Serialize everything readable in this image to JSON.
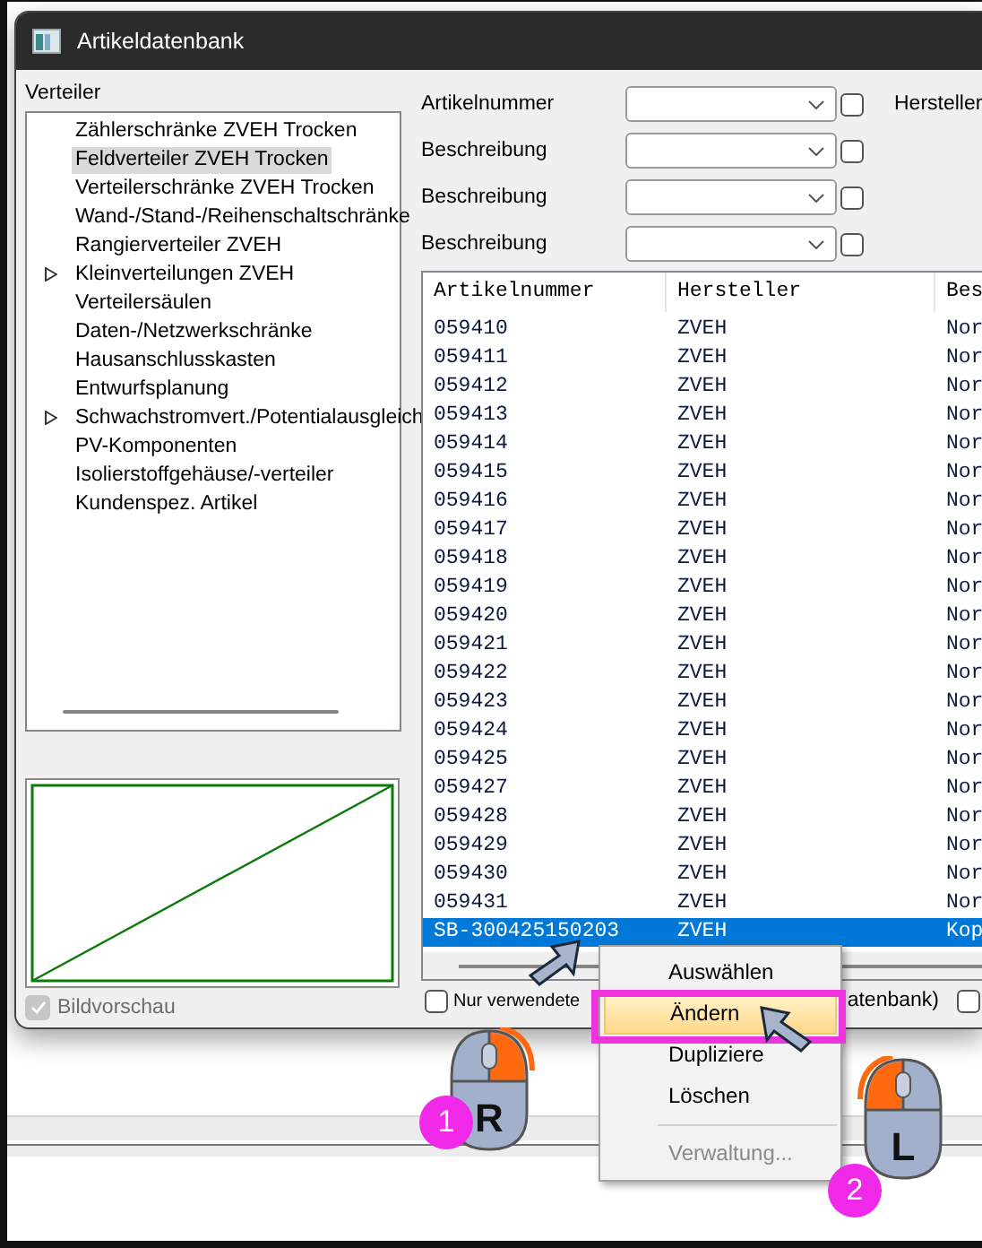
{
  "window": {
    "title": "Artikeldatenbank"
  },
  "tree": {
    "label": "Verteiler",
    "items": [
      {
        "label": "Zählerschränke ZVEH Trocken",
        "selected": false,
        "expandable": false
      },
      {
        "label": "Feldverteiler ZVEH Trocken",
        "selected": true,
        "expandable": false
      },
      {
        "label": "Verteilerschränke ZVEH Trocken",
        "selected": false,
        "expandable": false
      },
      {
        "label": "Wand-/Stand-/Reihenschaltschränke",
        "selected": false,
        "expandable": false
      },
      {
        "label": "Rangierverteiler ZVEH",
        "selected": false,
        "expandable": false
      },
      {
        "label": "Kleinverteilungen ZVEH",
        "selected": false,
        "expandable": true
      },
      {
        "label": "Verteilersäulen",
        "selected": false,
        "expandable": false
      },
      {
        "label": "Daten-/Netzwerkschränke",
        "selected": false,
        "expandable": false
      },
      {
        "label": "Hausanschlusskasten",
        "selected": false,
        "expandable": false
      },
      {
        "label": "Entwurfsplanung",
        "selected": false,
        "expandable": false
      },
      {
        "label": "Schwachstromvert./Potentialausgleich",
        "selected": false,
        "expandable": true
      },
      {
        "label": "PV-Komponenten",
        "selected": false,
        "expandable": false
      },
      {
        "label": "Isolierstoffgehäuse/-verteiler",
        "selected": false,
        "expandable": false
      },
      {
        "label": "Kundenspez. Artikel",
        "selected": false,
        "expandable": false
      }
    ]
  },
  "preview": {
    "label": "Bildvorschau",
    "checked": true,
    "disabled": true
  },
  "filters": [
    {
      "label": "Artikelnummer",
      "checked": false
    },
    {
      "label": "Beschreibung",
      "checked": false
    },
    {
      "label": "Beschreibung",
      "checked": false
    },
    {
      "label": "Beschreibung",
      "checked": false
    }
  ],
  "manufacturer_label": "Hersteller",
  "table": {
    "columns": [
      "Artikelnummer",
      "Hersteller",
      "Bes"
    ],
    "rows": [
      {
        "cells": [
          "059410",
          "ZVEH",
          "Nor"
        ],
        "selected": false
      },
      {
        "cells": [
          "059411",
          "ZVEH",
          "Nor"
        ],
        "selected": false
      },
      {
        "cells": [
          "059412",
          "ZVEH",
          "Nor"
        ],
        "selected": false
      },
      {
        "cells": [
          "059413",
          "ZVEH",
          "Nor"
        ],
        "selected": false
      },
      {
        "cells": [
          "059414",
          "ZVEH",
          "Nor"
        ],
        "selected": false
      },
      {
        "cells": [
          "059415",
          "ZVEH",
          "Nor"
        ],
        "selected": false
      },
      {
        "cells": [
          "059416",
          "ZVEH",
          "Nor"
        ],
        "selected": false
      },
      {
        "cells": [
          "059417",
          "ZVEH",
          "Nor"
        ],
        "selected": false
      },
      {
        "cells": [
          "059418",
          "ZVEH",
          "Nor"
        ],
        "selected": false
      },
      {
        "cells": [
          "059419",
          "ZVEH",
          "Nor"
        ],
        "selected": false
      },
      {
        "cells": [
          "059420",
          "ZVEH",
          "Nor"
        ],
        "selected": false
      },
      {
        "cells": [
          "059421",
          "ZVEH",
          "Nor"
        ],
        "selected": false
      },
      {
        "cells": [
          "059422",
          "ZVEH",
          "Nor"
        ],
        "selected": false
      },
      {
        "cells": [
          "059423",
          "ZVEH",
          "Nor"
        ],
        "selected": false
      },
      {
        "cells": [
          "059424",
          "ZVEH",
          "Nor"
        ],
        "selected": false
      },
      {
        "cells": [
          "059425",
          "ZVEH",
          "Nor"
        ],
        "selected": false
      },
      {
        "cells": [
          "059427",
          "ZVEH",
          "Nor"
        ],
        "selected": false
      },
      {
        "cells": [
          "059428",
          "ZVEH",
          "Nor"
        ],
        "selected": false
      },
      {
        "cells": [
          "059429",
          "ZVEH",
          "Nor"
        ],
        "selected": false
      },
      {
        "cells": [
          "059430",
          "ZVEH",
          "Nor"
        ],
        "selected": false
      },
      {
        "cells": [
          "059431",
          "ZVEH",
          "Nor"
        ],
        "selected": false
      },
      {
        "cells": [
          "SB-300425150203",
          "ZVEH",
          "Kop"
        ],
        "selected": true
      }
    ]
  },
  "bottom_options": {
    "label": "Nur verwendete",
    "checked": false,
    "tail": "atenbank)",
    "second_checked": false
  },
  "context_menu": {
    "items": [
      {
        "label": "Auswählen",
        "highlighted": false,
        "disabled": false,
        "separator_before": false
      },
      {
        "label": "Ändern",
        "highlighted": true,
        "disabled": false,
        "separator_before": false
      },
      {
        "label": "Dupliziere",
        "highlighted": false,
        "disabled": false,
        "separator_before": false
      },
      {
        "label": "Löschen",
        "highlighted": false,
        "disabled": false,
        "separator_before": false
      },
      {
        "label": "Verwaltung...",
        "highlighted": false,
        "disabled": true,
        "separator_before": true
      }
    ]
  },
  "steps": [
    {
      "number": "1",
      "button": "R"
    },
    {
      "number": "2",
      "button": "L"
    }
  ]
}
